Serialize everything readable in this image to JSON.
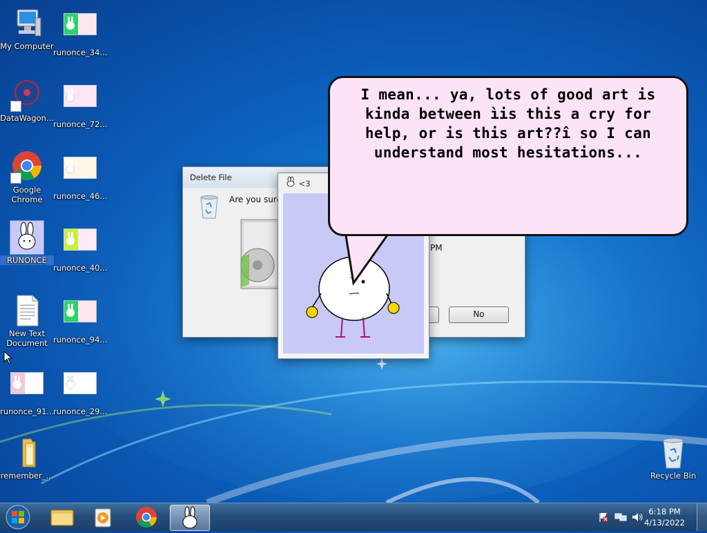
{
  "desktop": {
    "icons": [
      {
        "label": "My Computer"
      },
      {
        "label": "runonce_34..."
      },
      {
        "label": "DataWagon..."
      },
      {
        "label": "runonce_72..."
      },
      {
        "label": "Google Chrome"
      },
      {
        "label": "runonce_46..."
      },
      {
        "label": "RUNONCE"
      },
      {
        "label": "runonce_40..."
      },
      {
        "label": "New Text Document"
      },
      {
        "label": "runonce_94..."
      },
      {
        "label": "runonce_91..."
      },
      {
        "label": "runonce_29..."
      },
      {
        "label": "remember_..."
      },
      {
        "label": "Recycle Bin"
      }
    ]
  },
  "delete_dialog": {
    "title": "Delete File",
    "message": "Are you sure y",
    "date_fragment": "PM",
    "no_label": "No"
  },
  "bunny_window": {
    "title": "<3"
  },
  "bubble": {
    "text": "I mean... ya, lots of good art is kinda between ìis this a cry for help, or is this art??î so I can understand most hesitations..."
  },
  "taskbar": {
    "time": "6:18 PM",
    "date": "4/13/2022"
  },
  "colors": {
    "bubble_bg": "#fde3f6",
    "bunny_bg": "#c8c9f7",
    "taskbar": "#254e7c"
  }
}
